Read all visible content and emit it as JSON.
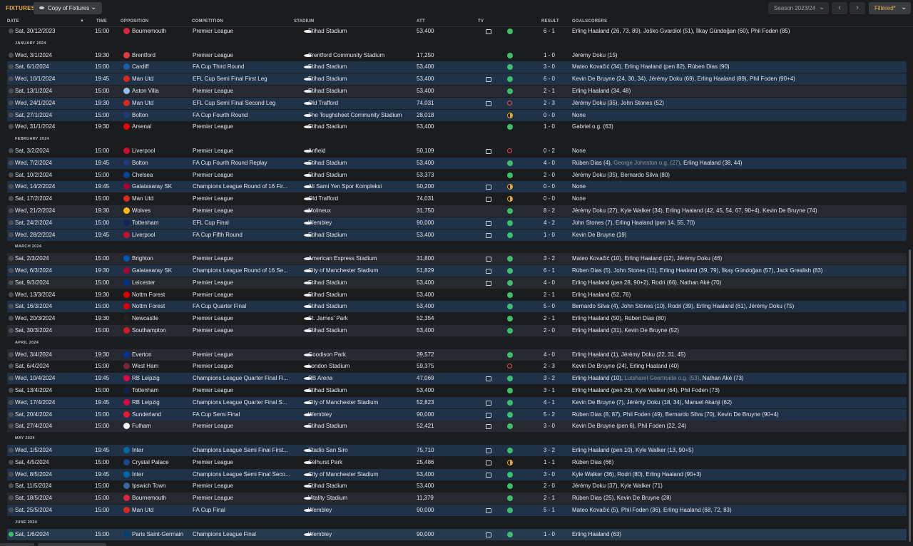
{
  "header": {
    "title": "FIXTURES",
    "view_label": "Copy of Fixtures",
    "season_label": "Season 2023/24",
    "filter_label": "Filtered*"
  },
  "columns": {
    "date": "DATE",
    "time": "TIME",
    "opposition": "OPPOSITION",
    "competition": "COMPETITION",
    "stadium": "STADIUM",
    "att": "ATT",
    "tv": "TV",
    "result": "RESULT",
    "goalscorers": "GOALSCORERS"
  },
  "colors": {
    "accent": "#e9b44c",
    "win": "#3cbf6b",
    "loss": "#e24b4b",
    "draw": "#e6a82a"
  },
  "rows": [
    {
      "kind": "fixture",
      "date": "Sat, 30/12/2023",
      "time": "15:00",
      "opp": "Bournemouth",
      "comp": "Premier League",
      "stadium": "Etihad Stadium",
      "att": "53,400",
      "tv": true,
      "outcome": "win",
      "result": "6 - 1",
      "scorers": "Erling Haaland (26, 73, 89), Joško Gvardiol (51), İlkay Gündoğan (60), Phil Foden (85)",
      "crest": "#d7263d",
      "style": "plain"
    },
    {
      "kind": "month",
      "label": "JANUARY 2024"
    },
    {
      "kind": "fixture",
      "date": "Wed, 3/1/2024",
      "time": "19:30",
      "opp": "Brentford",
      "comp": "Premier League",
      "stadium": "Brentford Community Stadium",
      "att": "17,250",
      "tv": false,
      "outcome": "win",
      "result": "1 - 0",
      "scorers": "Jérémy Doku (15)",
      "crest": "#e03a3e",
      "style": "plain"
    },
    {
      "kind": "fixture",
      "date": "Sat, 6/1/2024",
      "time": "15:00",
      "opp": "Cardiff",
      "comp": "FA Cup Third Round",
      "stadium": "Etihad Stadium",
      "att": "53,400",
      "tv": false,
      "outcome": "win",
      "result": "3 - 0",
      "scorers": "Mateo Kovačić (34), Erling Haaland (pen 82), Rúben Dias (90)",
      "crest": "#1a5ea8",
      "style": "hl"
    },
    {
      "kind": "fixture",
      "date": "Wed, 10/1/2024",
      "time": "19:45",
      "opp": "Man Utd",
      "comp": "EFL Cup Semi Final First Leg",
      "stadium": "Etihad Stadium",
      "att": "53,400",
      "tv": true,
      "outcome": "win",
      "result": "6 - 0",
      "scorers": "Kevin De Bruyne (24, 30, 34), Jérémy Doku (69), Erling Haaland (89), Phil Foden (90+4)",
      "crest": "#da291c",
      "style": "hl"
    },
    {
      "kind": "fixture",
      "date": "Sat, 13/1/2024",
      "time": "15:00",
      "opp": "Aston Villa",
      "comp": "Premier League",
      "stadium": "Etihad Stadium",
      "att": "53,400",
      "tv": false,
      "outcome": "win",
      "result": "2 - 1",
      "scorers": "Erling Haaland (34, 48)",
      "crest": "#95bfe5",
      "style": "plain"
    },
    {
      "kind": "fixture",
      "date": "Wed, 24/1/2024",
      "time": "19:30",
      "opp": "Man Utd",
      "comp": "EFL Cup Semi Final Second Leg",
      "stadium": "Old Trafford",
      "att": "74,031",
      "tv": true,
      "outcome": "loss",
      "result": "2 - 3",
      "scorers": "Jérémy Doku (35), John Stones (52)",
      "crest": "#da291c",
      "style": "hl"
    },
    {
      "kind": "fixture",
      "date": "Sat, 27/1/2024",
      "time": "15:00",
      "opp": "Bolton",
      "comp": "FA Cup Fourth Round",
      "stadium": "The Toughsheet Community Stadium",
      "att": "28,018",
      "tv": false,
      "outcome": "draw",
      "result": "0 - 0",
      "scorers": "None",
      "crest": "#1d3a7a",
      "style": "hl"
    },
    {
      "kind": "fixture",
      "date": "Wed, 31/1/2024",
      "time": "19:30",
      "opp": "Arsenal",
      "comp": "Premier League",
      "stadium": "Etihad Stadium",
      "att": "53,400",
      "tv": false,
      "outcome": "win",
      "result": "1 - 0",
      "scorers": "Gabriel o.g. (63)",
      "scorer_og": true,
      "crest": "#ef0107",
      "style": "plain"
    },
    {
      "kind": "month",
      "label": "FEBRUARY 2024"
    },
    {
      "kind": "fixture",
      "date": "Sat, 3/2/2024",
      "time": "15:00",
      "opp": "Liverpool",
      "comp": "Premier League",
      "stadium": "Anfield",
      "att": "50,109",
      "tv": true,
      "outcome": "loss",
      "result": "0 - 2",
      "scorers": "None",
      "crest": "#c8102e",
      "style": "plain"
    },
    {
      "kind": "fixture",
      "date": "Wed, 7/2/2024",
      "time": "19:45",
      "opp": "Bolton",
      "comp": "FA Cup Fourth Round Replay",
      "stadium": "Etihad Stadium",
      "att": "53,400",
      "tv": false,
      "outcome": "win",
      "result": "4 - 0",
      "scorers_parts": [
        "Rúben Dias (4), ",
        "George Johnston o.g. (27)",
        ", Erling Haaland (38, 44)"
      ],
      "crest": "#1d3a7a",
      "style": "hl"
    },
    {
      "kind": "fixture",
      "date": "Sat, 10/2/2024",
      "time": "15:00",
      "opp": "Chelsea",
      "comp": "Premier League",
      "stadium": "Etihad Stadium",
      "att": "53,373",
      "tv": false,
      "outcome": "win",
      "result": "2 - 0",
      "scorers": "Jérémy Doku (35), Bernardo Silva (80)",
      "crest": "#034694",
      "style": "plain"
    },
    {
      "kind": "fixture",
      "date": "Wed, 14/2/2024",
      "time": "19:45",
      "opp": "Galatasaray SK",
      "comp": "Champions League Round of 16 Fir...",
      "stadium": "Ali Sami Yen Spor Kompleksi",
      "att": "50,200",
      "tv": true,
      "outcome": "draw",
      "result": "0 - 0",
      "scorers": "None",
      "crest": "#a90432",
      "style": "hl"
    },
    {
      "kind": "fixture",
      "date": "Sat, 17/2/2024",
      "time": "15:00",
      "opp": "Man Utd",
      "comp": "Premier League",
      "stadium": "Old Trafford",
      "att": "74,031",
      "tv": true,
      "outcome": "draw",
      "result": "0 - 0",
      "scorers": "None",
      "crest": "#da291c",
      "style": "plain"
    },
    {
      "kind": "fixture",
      "date": "Wed, 21/2/2024",
      "time": "19:30",
      "opp": "Wolves",
      "comp": "Premier League",
      "stadium": "Molineux",
      "att": "31,750",
      "tv": false,
      "outcome": "win",
      "result": "8 - 2",
      "scorers": "Jérémy Doku (27), Kyle Walker (34), Erling Haaland (42, 45, 54, 67, 90+4), Kevin De Bruyne (74)",
      "crest": "#fdb913",
      "style": "plain"
    },
    {
      "kind": "fixture",
      "date": "Sat, 24/2/2024",
      "time": "15:00",
      "opp": "Tottenham",
      "comp": "EFL Cup Final",
      "stadium": "Wembley",
      "att": "90,000",
      "tv": true,
      "outcome": "win",
      "result": "4 - 2",
      "scorers": "John Stones (7), Erling Haaland (pen 14, 55, 70)",
      "crest": "#132257",
      "style": "hl"
    },
    {
      "kind": "fixture",
      "date": "Wed, 28/2/2024",
      "time": "19:45",
      "opp": "Liverpool",
      "comp": "FA Cup Fifth Round",
      "stadium": "Etihad Stadium",
      "att": "53,400",
      "tv": true,
      "outcome": "win",
      "result": "1 - 0",
      "scorers": "Kevin De Bruyne (19)",
      "crest": "#c8102e",
      "style": "hl"
    },
    {
      "kind": "month",
      "label": "MARCH 2024"
    },
    {
      "kind": "fixture",
      "date": "Sat, 2/3/2024",
      "time": "15:00",
      "opp": "Brighton",
      "comp": "Premier League",
      "stadium": "American Express Stadium",
      "att": "31,800",
      "tv": true,
      "outcome": "win",
      "result": "3 - 2",
      "scorers": "Mateo Kovačić (10), Erling Haaland (12), Jérémy Doku (46)",
      "crest": "#0057b8",
      "style": "plain"
    },
    {
      "kind": "fixture",
      "date": "Wed, 6/3/2024",
      "time": "19:30",
      "opp": "Galatasaray SK",
      "comp": "Champions League Round of 16 Se...",
      "stadium": "City of Manchester Stadium",
      "att": "51,829",
      "tv": true,
      "outcome": "win",
      "result": "6 - 1",
      "scorers": "Rúben Dias (5), John Stones (11), Erling Haaland (39, 79), İlkay Gündoğan (57), Jack Grealish (83)",
      "crest": "#a90432",
      "style": "hl"
    },
    {
      "kind": "fixture",
      "date": "Sat, 9/3/2024",
      "time": "15:00",
      "opp": "Leicester",
      "comp": "Premier League",
      "stadium": "Etihad Stadium",
      "att": "53,400",
      "tv": true,
      "outcome": "win",
      "result": "4 - 0",
      "scorers": "Erling Haaland (pen 28, 90+2), Rodri (66), Nathan Aké (70)",
      "crest": "#003090",
      "style": "plain"
    },
    {
      "kind": "fixture",
      "date": "Wed, 13/3/2024",
      "time": "19:30",
      "opp": "Nottm Forest",
      "comp": "Premier League",
      "stadium": "Etihad Stadium",
      "att": "53,400",
      "tv": false,
      "outcome": "win",
      "result": "2 - 1",
      "scorers": "Erling Haaland (52, 76)",
      "crest": "#dd0000",
      "style": "plain"
    },
    {
      "kind": "fixture",
      "date": "Sat, 16/3/2024",
      "time": "15:00",
      "opp": "Nottm Forest",
      "comp": "FA Cup Quarter Final",
      "stadium": "Etihad Stadium",
      "att": "53,400",
      "tv": false,
      "outcome": "win",
      "result": "5 - 0",
      "scorers": "Bernardo Silva (4), John Stones (10), Rodri (39), Erling Haaland (61), Jérémy Doku (75)",
      "crest": "#dd0000",
      "style": "hl"
    },
    {
      "kind": "fixture",
      "date": "Wed, 20/3/2024",
      "time": "19:30",
      "opp": "Newcastle",
      "comp": "Premier League",
      "stadium": "St. James' Park",
      "att": "52,354",
      "tv": false,
      "outcome": "win",
      "result": "2 - 1",
      "scorers": "Erling Haaland (50), Rúben Dias (80)",
      "crest": "#241f20",
      "style": "plain"
    },
    {
      "kind": "fixture",
      "date": "Sat, 30/3/2024",
      "time": "15:00",
      "opp": "Southampton",
      "comp": "Premier League",
      "stadium": "Etihad Stadium",
      "att": "53,400",
      "tv": false,
      "outcome": "win",
      "result": "2 - 0",
      "scorers": "Erling Haaland (31), Kevin De Bruyne (52)",
      "crest": "#d71920",
      "style": "plain"
    },
    {
      "kind": "month",
      "label": "APRIL 2024"
    },
    {
      "kind": "fixture",
      "date": "Wed, 3/4/2024",
      "time": "19:30",
      "opp": "Everton",
      "comp": "Premier League",
      "stadium": "Goodison Park",
      "att": "39,572",
      "tv": false,
      "outcome": "win",
      "result": "4 - 0",
      "scorers": "Erling Haaland (1), Jérémy Doku (22, 31, 45)",
      "crest": "#003399",
      "style": "plain"
    },
    {
      "kind": "fixture",
      "date": "Sat, 6/4/2024",
      "time": "15:00",
      "opp": "West Ham",
      "comp": "Premier League",
      "stadium": "London Stadium",
      "att": "59,375",
      "tv": false,
      "outcome": "loss",
      "result": "2 - 3",
      "scorers": "Kevin De Bruyne (24), Erling Haaland (40)",
      "crest": "#7a263a",
      "style": "plain"
    },
    {
      "kind": "fixture",
      "date": "Wed, 10/4/2024",
      "time": "19:45",
      "opp": "RB Leipzig",
      "comp": "Champions League Quarter Final Fi...",
      "stadium": "RB Arena",
      "att": "47,069",
      "tv": true,
      "outcome": "win",
      "result": "3 - 2",
      "scorers_parts": [
        "Erling Haaland (10), ",
        "Lutsharel Geertruida o.g. (53)",
        ", Nathan Aké (73)"
      ],
      "crest": "#dd0741",
      "style": "hl"
    },
    {
      "kind": "fixture",
      "date": "Sat, 13/4/2024",
      "time": "15:00",
      "opp": "Tottenham",
      "comp": "Premier League",
      "stadium": "Etihad Stadium",
      "att": "53,400",
      "tv": false,
      "outcome": "win",
      "result": "3 - 1",
      "scorers": "Erling Haaland (pen 26), Kyle Walker (64), Phil Foden (73)",
      "crest": "#132257",
      "style": "plain"
    },
    {
      "kind": "fixture",
      "date": "Wed, 17/4/2024",
      "time": "19:45",
      "opp": "RB Leipzig",
      "comp": "Champions League Quarter Final S...",
      "stadium": "City of Manchester Stadium",
      "att": "52,823",
      "tv": true,
      "outcome": "win",
      "result": "4 - 1",
      "scorers": "Kevin De Bruyne (7), Jérémy Doku (18, 34), Manuel Akanji (62)",
      "crest": "#dd0741",
      "style": "hl"
    },
    {
      "kind": "fixture",
      "date": "Sat, 20/4/2024",
      "time": "15:00",
      "opp": "Sunderland",
      "comp": "FA Cup Semi Final",
      "stadium": "Wembley",
      "att": "90,000",
      "tv": true,
      "outcome": "win",
      "result": "5 - 2",
      "scorers": "Rúben Dias (8, 87), Phil Foden (49), Bernardo Silva (70), Kevin De Bruyne (90+4)",
      "crest": "#eb172b",
      "style": "hl"
    },
    {
      "kind": "fixture",
      "date": "Sat, 27/4/2024",
      "time": "15:00",
      "opp": "Fulham",
      "comp": "Premier League",
      "stadium": "Etihad Stadium",
      "att": "52,421",
      "tv": true,
      "outcome": "win",
      "result": "3 - 0",
      "scorers": "Kevin De Bruyne (pen 6), Phil Foden (22, 24)",
      "crest": "#f5f5f5",
      "style": "plain"
    },
    {
      "kind": "month",
      "label": "MAY 2024"
    },
    {
      "kind": "fixture",
      "date": "Wed, 1/5/2024",
      "time": "19:45",
      "opp": "Inter",
      "comp": "Champions League Semi Final First...",
      "stadium": "Stadio San Siro",
      "att": "75,710",
      "tv": true,
      "outcome": "win",
      "result": "3 - 2",
      "scorers": "Erling Haaland (pen 10), Kyle Walker (13, 90+5)",
      "crest": "#0068a8",
      "style": "hl"
    },
    {
      "kind": "fixture",
      "date": "Sat, 4/5/2024",
      "time": "15:00",
      "opp": "Crystal Palace",
      "comp": "Premier League",
      "stadium": "Selhurst Park",
      "att": "25,486",
      "tv": true,
      "outcome": "draw",
      "result": "1 - 1",
      "scorers": "Rúben Dias (66)",
      "crest": "#1b458f",
      "style": "plain"
    },
    {
      "kind": "fixture",
      "date": "Wed, 8/5/2024",
      "time": "19:45",
      "opp": "Inter",
      "comp": "Champions League Semi Final Seco...",
      "stadium": "City of Manchester Stadium",
      "att": "53,400",
      "tv": true,
      "outcome": "win",
      "result": "3 - 0",
      "scorers": "Kyle Walker (36), Rodri (80), Erling Haaland (90+3)",
      "crest": "#0068a8",
      "style": "hl"
    },
    {
      "kind": "fixture",
      "date": "Sat, 11/5/2024",
      "time": "15:00",
      "opp": "Ipswich Town",
      "comp": "Premier League",
      "stadium": "Etihad Stadium",
      "att": "53,400",
      "tv": false,
      "outcome": "win",
      "result": "2 - 0",
      "scorers": "Jérémy Doku (37), Kyle Walker (71)",
      "crest": "#3a64a3",
      "style": "plain"
    },
    {
      "kind": "fixture",
      "date": "Sat, 18/5/2024",
      "time": "15:00",
      "opp": "Bournemouth",
      "comp": "Premier League",
      "stadium": "Vitality Stadium",
      "att": "11,379",
      "tv": false,
      "outcome": "win",
      "result": "2 - 1",
      "scorers": "Rúben Dias (25), Kevin De Bruyne (28)",
      "crest": "#d7263d",
      "style": "plain"
    },
    {
      "kind": "fixture",
      "date": "Sat, 25/5/2024",
      "time": "15:00",
      "opp": "Man Utd",
      "comp": "FA Cup Final",
      "stadium": "Wembley",
      "att": "90,000",
      "tv": true,
      "outcome": "win",
      "result": "5 - 1",
      "scorers": "Mateo Kovačić (5), Phil Foden (36), Erling Haaland (68, 72, 83)",
      "crest": "#da291c",
      "style": "hl"
    },
    {
      "kind": "month",
      "label": "JUNE 2024"
    },
    {
      "kind": "fixture",
      "date": "Sat, 1/6/2024",
      "time": "15:00",
      "opp": "Paris Saint-Germain",
      "comp": "Champions League Final",
      "stadium": "Wembley",
      "att": "90,000",
      "tv": true,
      "outcome": "win",
      "result": "1 - 0",
      "scorers": "Erling Haaland (63)",
      "crest": "#004170",
      "style": "next"
    }
  ]
}
